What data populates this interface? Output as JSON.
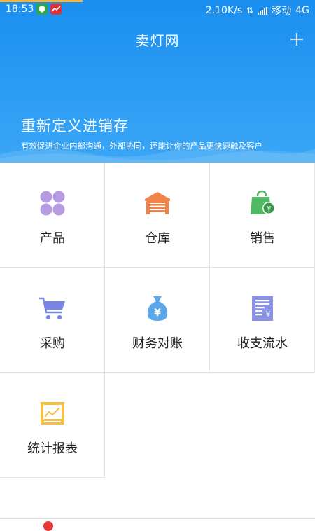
{
  "status_bar": {
    "time": "18:53",
    "speed": "2.10K/s",
    "carrier": "移动",
    "network": "4G"
  },
  "header": {
    "title": "卖灯网",
    "add_icon": "plus-icon",
    "hero_title": "重新定义进销存",
    "hero_subtitle": "有效促进企业内部沟通，外部协同，还能让你的产品更快速触及客户"
  },
  "menu": [
    {
      "label": "产品",
      "icon": "four-circles-icon",
      "color": "#b79be0"
    },
    {
      "label": "仓库",
      "icon": "warehouse-icon",
      "color": "#f0834a"
    },
    {
      "label": "销售",
      "icon": "shopping-bag-yen-icon",
      "color": "#4fb862"
    },
    {
      "label": "采购",
      "icon": "cart-icon",
      "color": "#7a86e4"
    },
    {
      "label": "财务对账",
      "icon": "money-bag-icon",
      "color": "#5aa8ea"
    },
    {
      "label": "收支流水",
      "icon": "receipt-icon",
      "color": "#8a93e6"
    },
    {
      "label": "统计报表",
      "icon": "report-icon",
      "color": "#f2c049"
    }
  ],
  "colors": {
    "header_blue": "#1a8ff0",
    "accent_orange": "#f4b33a"
  }
}
